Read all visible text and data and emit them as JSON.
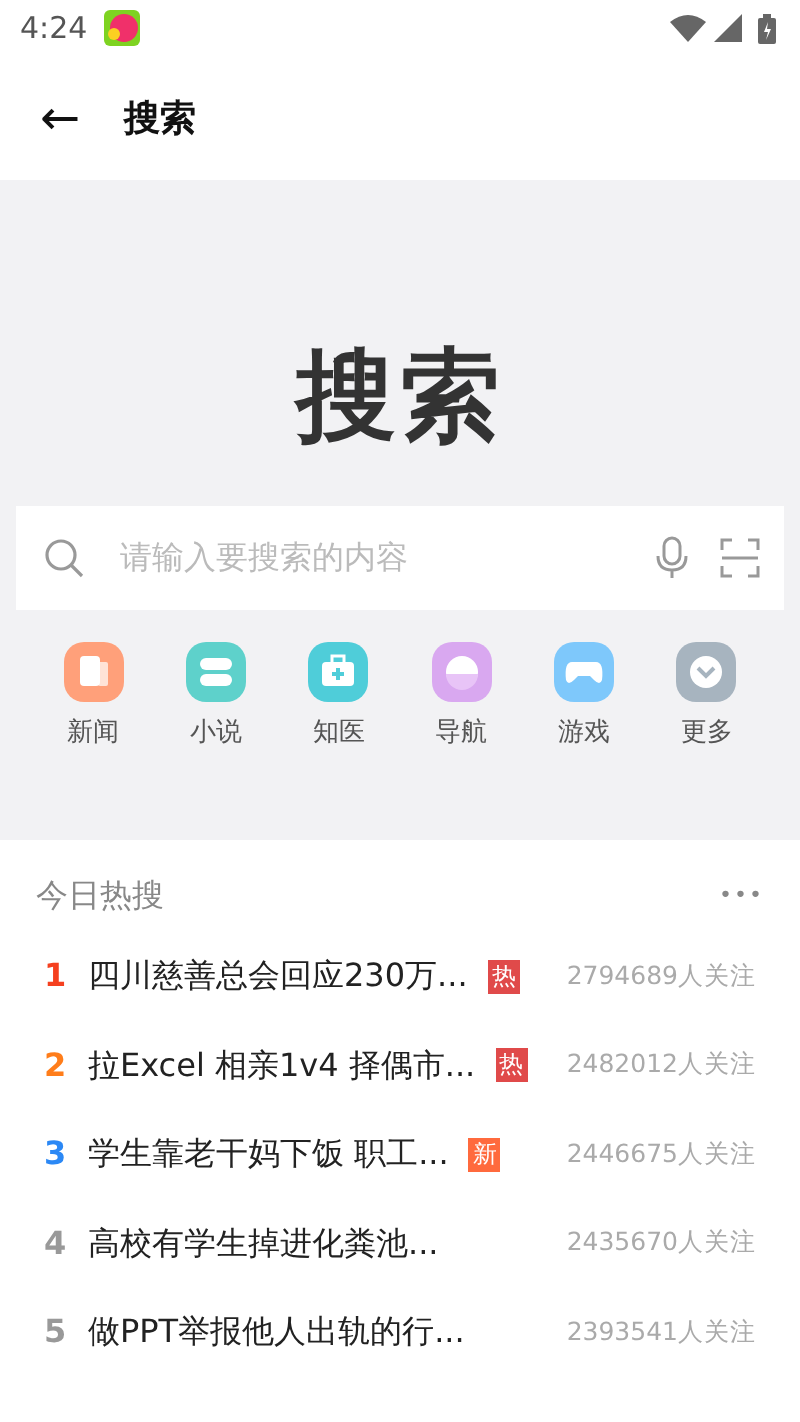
{
  "status_bar": {
    "time": "4:24"
  },
  "header": {
    "back": "←",
    "title": "搜索"
  },
  "hero": {
    "title": "搜索"
  },
  "search": {
    "placeholder": "请输入要搜索的内容"
  },
  "shortcuts": [
    {
      "label": "新闻",
      "kind": "news",
      "color": "#ffa07a"
    },
    {
      "label": "小说",
      "kind": "novel",
      "color": "#5ed1cb"
    },
    {
      "label": "知医",
      "kind": "medical",
      "color": "#4fcdd9"
    },
    {
      "label": "导航",
      "kind": "nav",
      "color": "#d9a8f0"
    },
    {
      "label": "游戏",
      "kind": "game",
      "color": "#7ec8fb"
    },
    {
      "label": "更多",
      "kind": "more",
      "color": "#a7b4bf"
    }
  ],
  "hot": {
    "title": "今日热搜",
    "more": "•••",
    "items": [
      {
        "rank": "1",
        "color": "#f5401f",
        "title": "四川慈善总会回应230万...",
        "badge": {
          "kind": "hot",
          "text": "热"
        },
        "follow": "2794689人关注"
      },
      {
        "rank": "2",
        "color": "#ff7d1a",
        "title": "拉Excel 相亲1v4 择偶市...",
        "badge": {
          "kind": "hot",
          "text": "热"
        },
        "follow": "2482012人关注"
      },
      {
        "rank": "3",
        "color": "#2b88f5",
        "title": "学生靠老干妈下饭 职工...",
        "badge": {
          "kind": "new",
          "text": "新"
        },
        "follow": "2446675人关注"
      },
      {
        "rank": "4",
        "color": "#999999",
        "title": "高校有学生掉进化粪池...",
        "follow": "2435670人关注"
      },
      {
        "rank": "5",
        "color": "#999999",
        "title": "做PPT举报他人出轨的行...",
        "follow": "2393541人关注"
      }
    ]
  }
}
